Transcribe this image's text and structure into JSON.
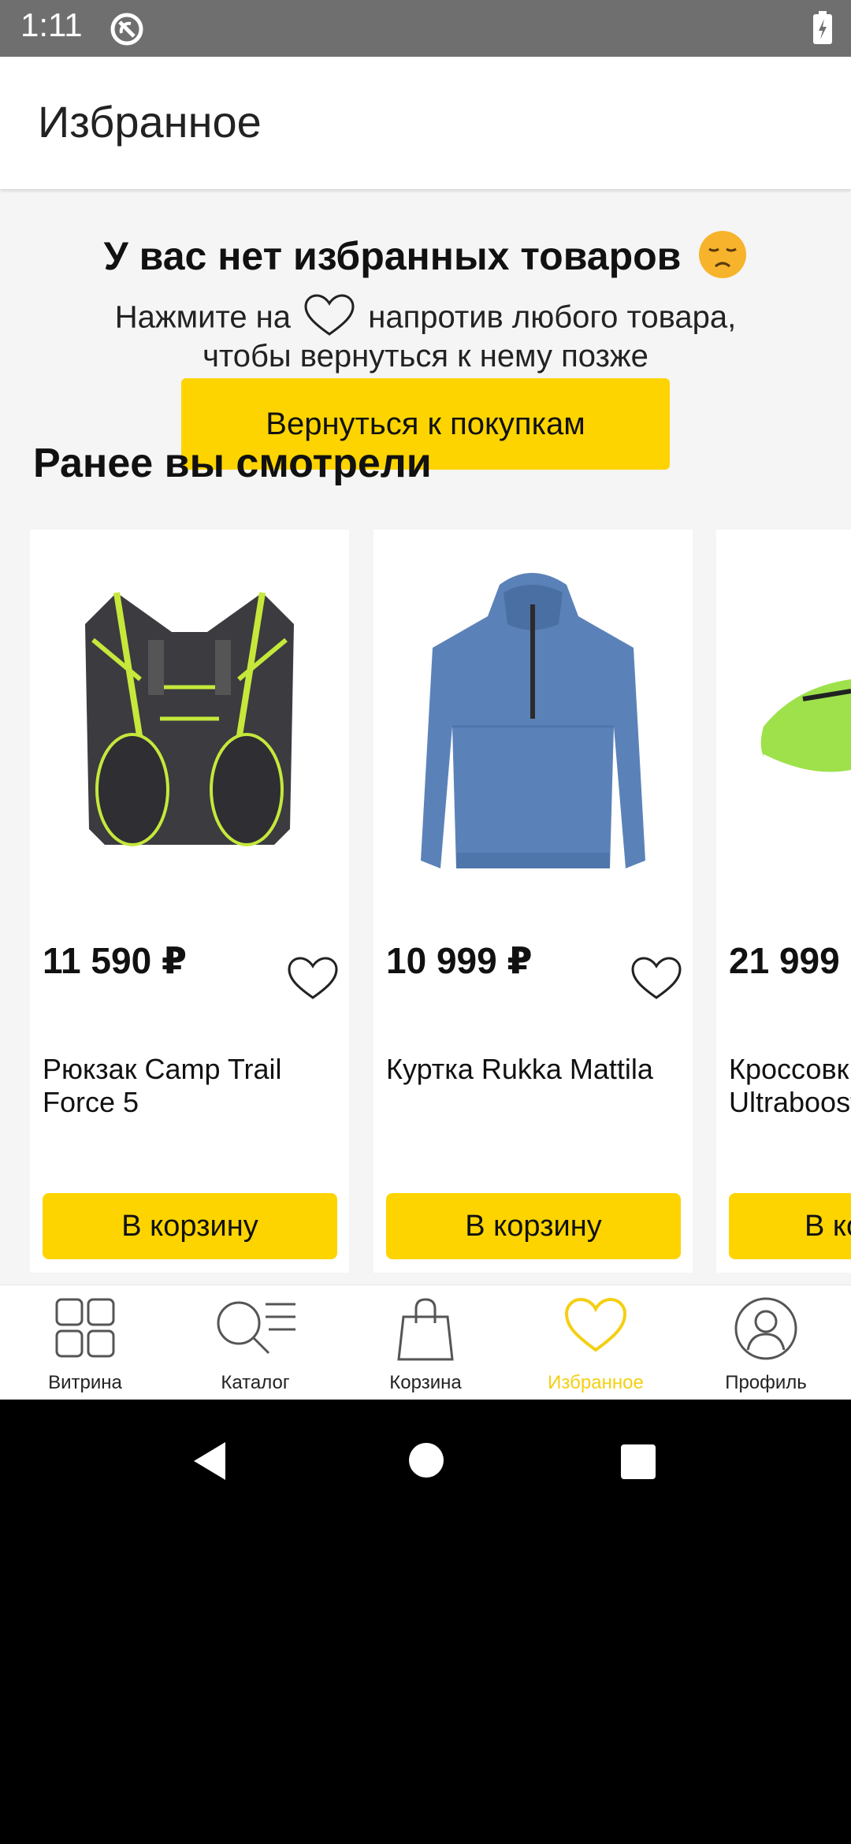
{
  "status": {
    "time": "1:11"
  },
  "header": {
    "title": "Избранное"
  },
  "empty": {
    "title": "У вас нет избранных товаров",
    "line1_before": "Нажмите на",
    "line1_after": "напротив любого товара,",
    "line2": "чтобы вернуться к нему позже",
    "button": "Вернуться к покупкам"
  },
  "recent": {
    "title": "Ранее вы смотрели",
    "items": [
      {
        "price": "11 590 ₽",
        "name": "Рюкзак Camp Trail\nForce 5",
        "button": "В корзину"
      },
      {
        "price": "10 999 ₽",
        "name": "Куртка Rukka Mattila",
        "button": "В корзину"
      },
      {
        "price": "21 999",
        "name": "Кроссовк\nUltraboost",
        "button": "В ко"
      }
    ]
  },
  "nav": {
    "items": [
      {
        "label": "Витрина",
        "icon": "grid-icon"
      },
      {
        "label": "Каталог",
        "icon": "search-list-icon"
      },
      {
        "label": "Корзина",
        "icon": "bag-icon"
      },
      {
        "label": "Избранное",
        "icon": "heart-icon"
      },
      {
        "label": "Профиль",
        "icon": "profile-icon"
      }
    ],
    "active_color": "#f4cf12"
  },
  "colors": {
    "accent": "#fdd400",
    "background": "#f5f5f5"
  }
}
